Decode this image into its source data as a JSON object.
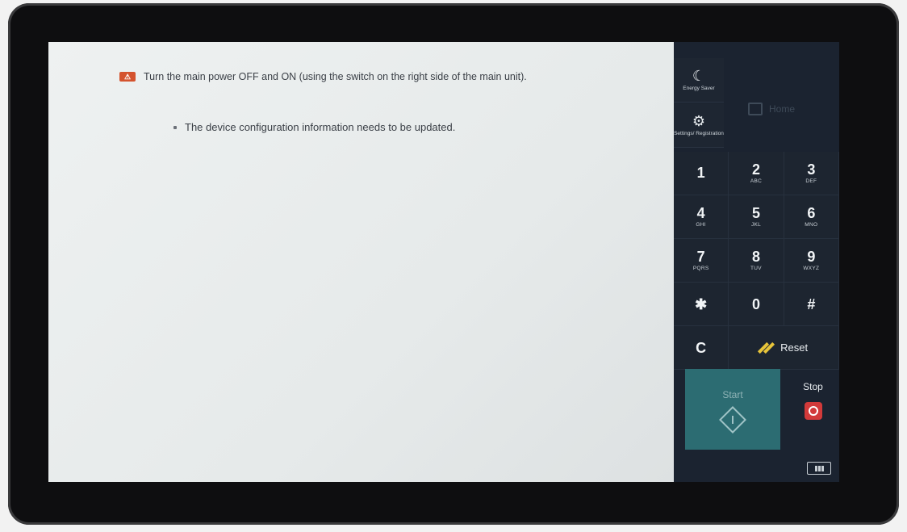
{
  "message": {
    "main_text": "Turn the main power OFF and ON (using the switch on the right side of the main unit).",
    "detail_text": "The device configuration information needs to be updated."
  },
  "panel": {
    "energy_saver_label": "Energy Saver",
    "settings_label": "Settings/ Registration",
    "home_label": "Home",
    "keys": [
      {
        "num": "1",
        "letters": ""
      },
      {
        "num": "2",
        "letters": "ABC"
      },
      {
        "num": "3",
        "letters": "DEF"
      },
      {
        "num": "4",
        "letters": "GHI"
      },
      {
        "num": "5",
        "letters": "JKL"
      },
      {
        "num": "6",
        "letters": "MNO"
      },
      {
        "num": "7",
        "letters": "PQRS"
      },
      {
        "num": "8",
        "letters": "TUV"
      },
      {
        "num": "9",
        "letters": "WXYZ"
      },
      {
        "num": "✱",
        "letters": ""
      },
      {
        "num": "0",
        "letters": ""
      },
      {
        "num": "#",
        "letters": ""
      }
    ],
    "clear_label": "C",
    "reset_label": "Reset",
    "start_label": "Start",
    "stop_label": "Stop"
  },
  "colors": {
    "warning_icon": "#d4532e",
    "start_button": "#2c6c72",
    "stop_button": "#d23a3a",
    "reset_icon": "#e7c43a"
  },
  "icons": [
    "warning-icon",
    "moon-icon",
    "gear-icon",
    "home-icon",
    "reset-icon",
    "start-icon",
    "stop-icon",
    "counter-icon"
  ]
}
